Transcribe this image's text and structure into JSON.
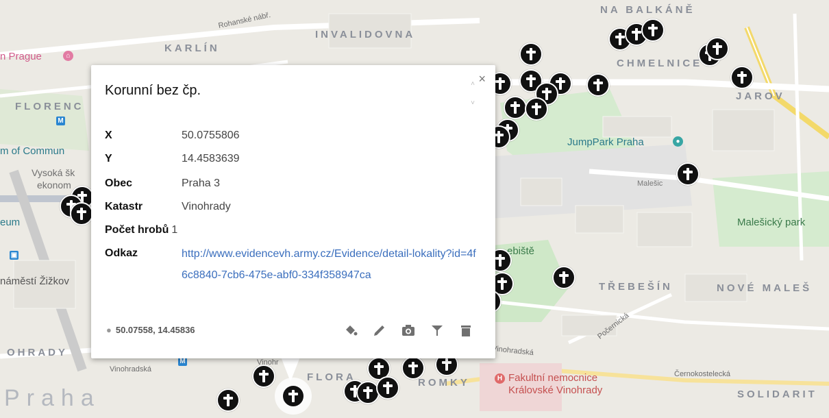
{
  "popup": {
    "title": "Korunní bez čp.",
    "close_symbol": "×",
    "scroll_up": "˄",
    "scroll_down": "˅",
    "fields": [
      {
        "key": "X",
        "value": "50.0755806"
      },
      {
        "key": "Y",
        "value": "14.4583639"
      },
      {
        "key": "Obec",
        "value": "Praha 3"
      },
      {
        "key": "Katastr",
        "value": "Vinohrady"
      },
      {
        "key": "Počet hrobů",
        "value": "1"
      }
    ],
    "link_key": "Odkaz",
    "link_text": "http://www.evidencevh.army.cz/Evidence/detail-lokality?id=4f6c8840-7cb6-475e-abf0-334f358947ca",
    "coordinates": "50.07558, 14.45836",
    "tools": [
      "paint-bucket-icon",
      "pencil-icon",
      "camera-icon",
      "filter-icon",
      "trash-icon"
    ]
  },
  "map": {
    "area_labels": [
      "NA BALKÁNĚ",
      "INVALIDOVNA",
      "KARLÍN",
      "CHMELNICE",
      "FLORENC",
      "JAROV",
      "TŘEBEŠÍN",
      "NOVÉ MALEŠ",
      "OHRADY",
      "SOLIDARIT",
      "FLORA",
      "ROMKY",
      "Praha"
    ],
    "places": [
      "n Prague",
      "m of Commun",
      "Vysoká šk",
      "ekonom",
      "eum",
      "náměstí Žižkov",
      "JumpPark Praha",
      "Malešický park",
      "ebiště",
      "Fakultní nemocnice",
      "Královské Vinohrady",
      "Malešic"
    ],
    "roads": [
      "Rohanské nábř.",
      "Vinohradská",
      "Vinohradská",
      "Počernická",
      "Černokostelecká",
      "Vinohr"
    ],
    "metro_symbol": "M",
    "colors": {
      "park": "#c8e6c9",
      "road": "#ffffff",
      "major_road": "#f6d96b",
      "water": "#aadaff",
      "pin": "#111111",
      "link": "#3a6ebd"
    }
  }
}
